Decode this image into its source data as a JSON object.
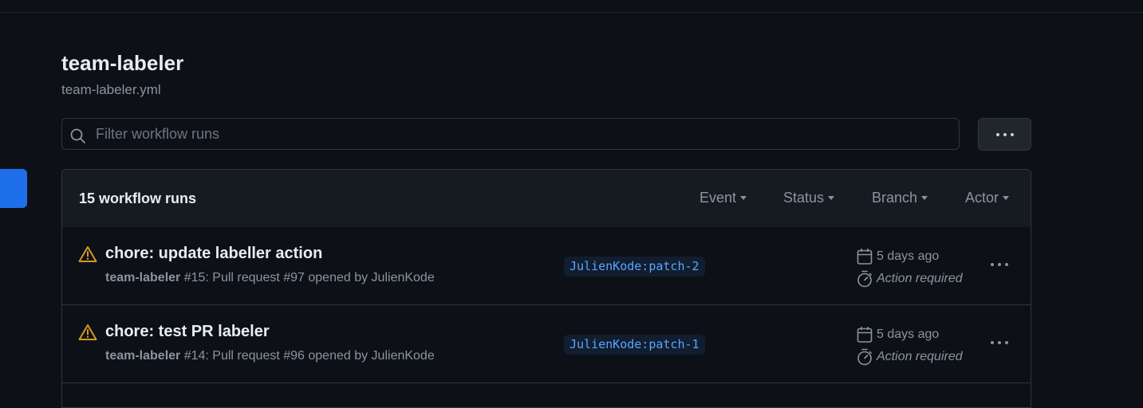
{
  "page": {
    "title": "team-labeler",
    "subtitle": "team-labeler.yml"
  },
  "filter": {
    "placeholder": "Filter workflow runs",
    "value": ""
  },
  "runs_header": {
    "count_label": "15 workflow runs",
    "filters": [
      "Event",
      "Status",
      "Branch",
      "Actor"
    ]
  },
  "runs": [
    {
      "title": "chore: update labeller action",
      "workflow": "team-labeler",
      "meta": " #15: Pull request #97 opened by JulienKode",
      "branch": "JulienKode:patch-2",
      "when": "5 days ago",
      "status": "Action required"
    },
    {
      "title": "chore: test PR labeler",
      "workflow": "team-labeler",
      "meta": " #14: Pull request #96 opened by JulienKode",
      "branch": "JulienKode:patch-1",
      "when": "5 days ago",
      "status": "Action required"
    }
  ],
  "icons": {
    "search": "search-icon",
    "more": "kebab-horizontal-icon",
    "warning": "alert-icon",
    "calendar": "calendar-icon",
    "stopwatch": "stopwatch-icon"
  },
  "colors": {
    "background": "#0d1117",
    "accent": "#1f6feb",
    "warning": "#d29922",
    "branch": "#58a6ff"
  }
}
